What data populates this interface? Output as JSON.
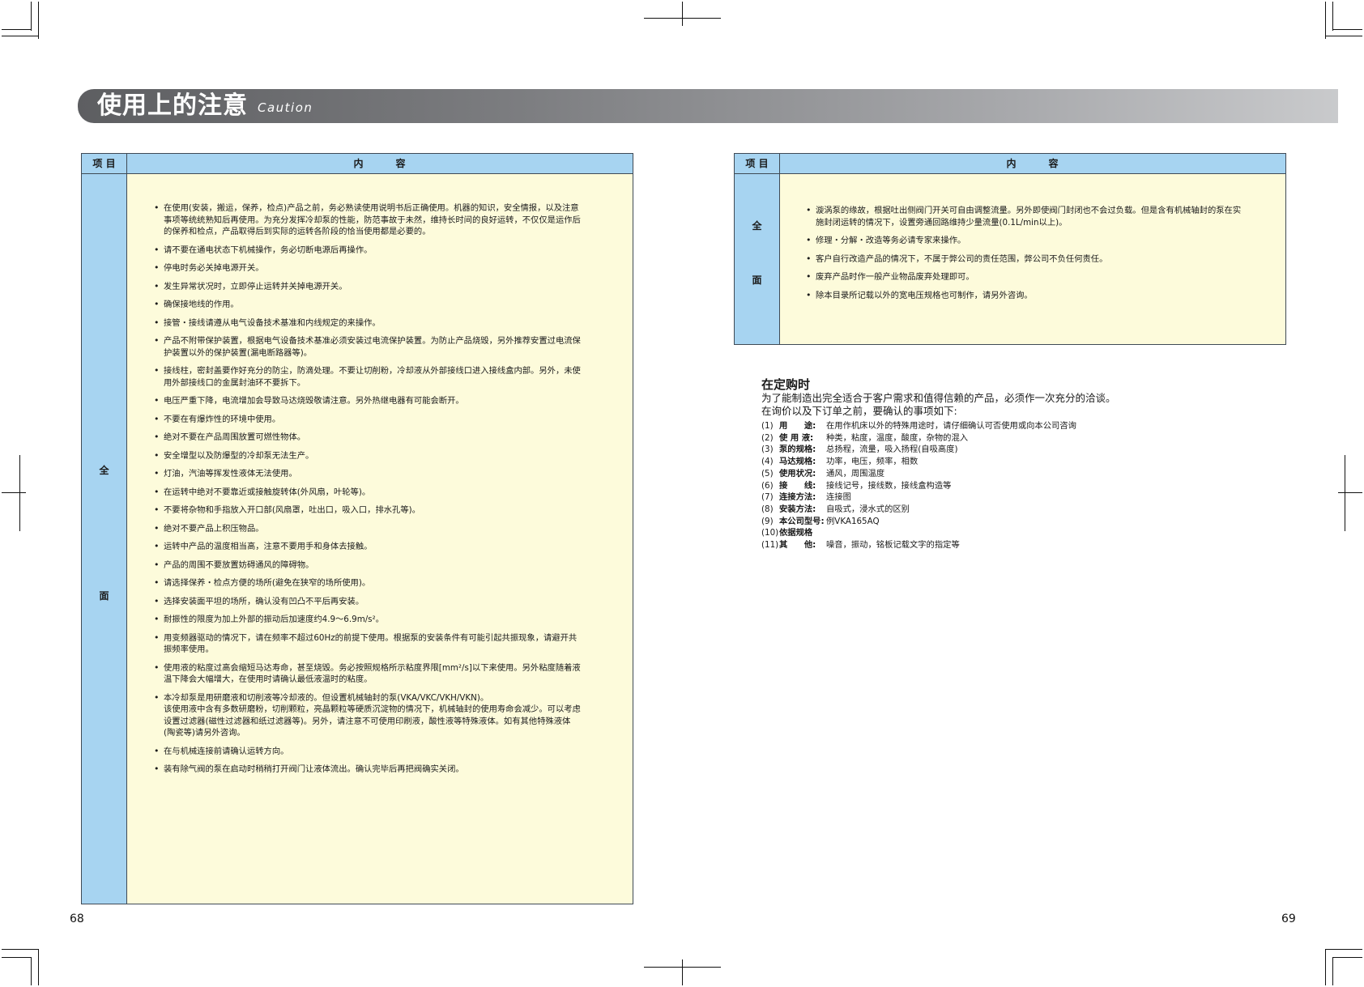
{
  "header": {
    "title": "使用上的注意",
    "subtitle": "Caution"
  },
  "left_table": {
    "header_item": "项 目",
    "header_content": "内　　　容",
    "item_chars": [
      "全",
      "面"
    ],
    "bullets": [
      "在使用(安装，搬运，保养，检点)产品之前，务必熟读使用说明书后正确使用。机器的知识，安全情报，以及注意\n事项等统统熟知后再使用。为充分发挥冷却泵的性能，防范事故于未然，维持长时间的良好运转，不仅仅是运作后\n的保养和检点，产品取得后到实际的运转各阶段的恰当使用都是必要的。",
      "请不要在通电状态下机械操作，务必切断电源后再操作。",
      "停电时务必关掉电源开关。",
      "发生异常状况时，立即停止运转并关掉电源开关。",
      "确保接地线的作用。",
      "接管・接线请遵从电气设备技术基准和内线规定的来操作。",
      "产品不附带保护装置，根据电气设备技术基准必须安装过电流保护装置。为防止产品烧毁，另外推荐安置过电流保\n护装置以外的保护装置(漏电断路器等)。",
      "接线柱，密封盖要作好充分的防尘，防滴处理。不要让切削粉，冷却液从外部接线口进入接线盒内部。另外，未使\n用外部接线口的金属封油环不要拆下。",
      "电压严重下降，电流增加会导致马达烧毁敬请注意。另外热继电器有可能会断开。",
      "不要在有爆炸性的环境中使用。",
      "绝对不要在产品周围放置可燃性物体。",
      "安全增型以及防爆型的冷却泵无法生产。",
      "灯油，汽油等挥发性液体无法使用。",
      "在运转中绝对不要靠近或接触旋转体(外风扇，叶轮等)。",
      "不要将杂物和手指放入开口部(风扇罩，吐出口，吸入口，排水孔等)。",
      "绝对不要产品上积压物品。",
      "运转中产品的温度相当高，注意不要用手和身体去接触。",
      "产品的周围不要放置妨碍通风的障碍物。",
      "请选择保养・检点方便的场所(避免在狭窄的场所使用)。",
      "选择安装面平坦的场所，确认没有凹凸不平后再安装。",
      "耐振性的限度为加上外部的振动后加速度约4.9～6.9m/s²。",
      "用变频器驱动的情况下，请在频率不超过60Hz的前提下使用。根据泵的安装条件有可能引起共振现象，请避开共\n振频率使用。",
      "使用液的粘度过高会缩短马达寿命，甚至烧毁。务必按照规格所示粘度界限[mm²/s]以下来使用。另外粘度随着液\n温下降会大幅增大，在使用时请确认最低液温时的粘度。",
      "本冷却泵是用研磨液和切削液等冷却液的。但设置机械轴封的泵(VKA/VKC/VKH/VKN)。\n该使用液中含有多数研磨粉，切削颗粒，亮晶颗粒等硬质沉淀物的情况下，机械轴封的使用寿命会减少。可以考虑\n设置过滤器(磁性过滤器和纸过滤器等)。另外，请注意不可使用印刷液，酸性液等特殊液体。如有其他特殊液体\n(陶瓷等)请另外咨询。",
      "在与机械连接前请确认运转方向。",
      "装有除气阀的泵在启动时稍稍打开阀门让液体流出。确认完毕后再把阀确实关闭。"
    ]
  },
  "right_table": {
    "header_item": "项 目",
    "header_content": "内　　　容",
    "item_chars": [
      "全",
      "面"
    ],
    "bullets": [
      "漩涡泵的缘故，根据吐出侧阀门开关可自由调整流量。另外即使阀门封闭也不会过负载。但是含有机械轴封的泵在实\n施封闭运转的情况下，设置旁通回路维持少量流量(0.1L/min以上)。",
      "修理・分解・改造等务必请专家来操作。",
      "客户自行改造产品的情况下，不属于弊公司的责任范围，弊公司不负任何责任。",
      "废弃产品时作一般产业物品废弃处理即可。",
      "除本目录所记载以外的宽电压规格也可制作，请另外咨询。"
    ]
  },
  "order": {
    "heading": "在定购时",
    "intro_1": "为了能制造出完全适合于客户需求和值得信赖的产品，必须作一次充分的洽谈。",
    "intro_2": "在询价以及下订单之前，要确认的事项如下:",
    "items": [
      {
        "num": "(1)",
        "label": "用　　途:",
        "text": "在用作机床以外的特殊用途时，请仔细确认可否使用或向本公司咨询"
      },
      {
        "num": "(2)",
        "label": "使 用 液:",
        "text": "种类，粘度，温度，酸度，杂物的混入"
      },
      {
        "num": "(3)",
        "label": "泵的规格:",
        "text": "总扬程，流量，吸入扬程(自吸高度)"
      },
      {
        "num": "(4)",
        "label": "马达规格:",
        "text": "功率，电压，频率，相数"
      },
      {
        "num": "(5)",
        "label": "使用状况:",
        "text": "通风，周围温度"
      },
      {
        "num": "(6)",
        "label": "接　　线:",
        "text": "接线记号，接线数，接线盒构造等"
      },
      {
        "num": "(7)",
        "label": "连接方法:",
        "text": "连接图"
      },
      {
        "num": "(8)",
        "label": "安装方法:",
        "text": "自吸式，浸水式的区别"
      },
      {
        "num": "(9)",
        "label": "本公司型号:",
        "text": "例VKA165AQ"
      },
      {
        "num": "(10)",
        "label": "依据规格",
        "text": ""
      },
      {
        "num": "(11)",
        "label": "其　　他:",
        "text": "噪音，振动，铭板记载文字的指定等"
      }
    ]
  },
  "page_numbers": {
    "left": "68",
    "right": "69"
  }
}
